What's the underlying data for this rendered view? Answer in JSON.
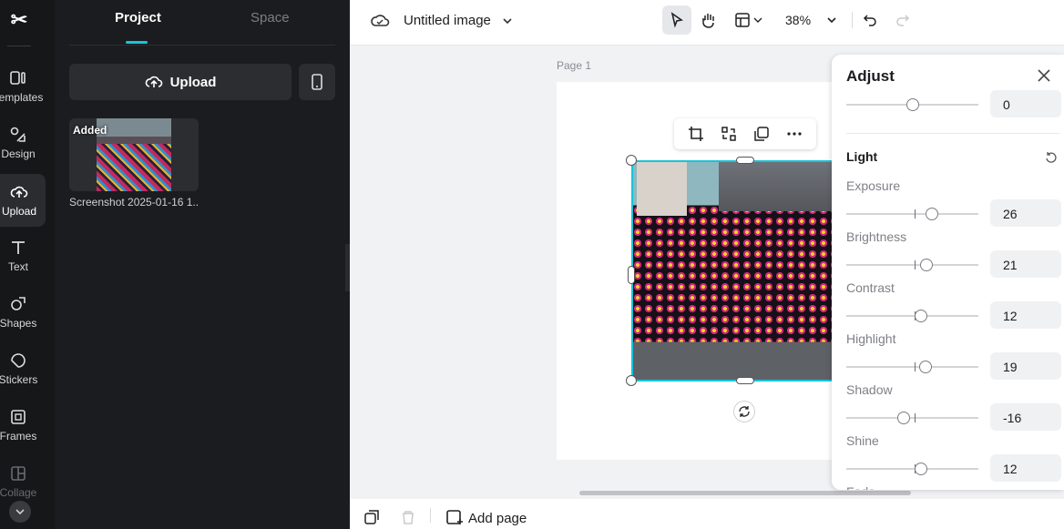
{
  "app": {
    "logo": "CapCut",
    "logo_glyph": "✂"
  },
  "rail": {
    "items": [
      {
        "label": "Templates",
        "icon": "templates-icon"
      },
      {
        "label": "Design",
        "icon": "design-icon"
      },
      {
        "label": "Upload",
        "icon": "upload-cloud-icon"
      },
      {
        "label": "Text",
        "icon": "text-icon"
      },
      {
        "label": "Shapes",
        "icon": "shapes-icon"
      },
      {
        "label": "Stickers",
        "icon": "stickers-icon"
      },
      {
        "label": "Frames",
        "icon": "frames-icon"
      },
      {
        "label": "Collage",
        "icon": "collage-icon"
      }
    ]
  },
  "panel": {
    "tabs": [
      "Project",
      "Space"
    ],
    "upload_label": "Upload",
    "media": {
      "badge": "Added",
      "name": "Screenshot 2025-01-16 1..."
    }
  },
  "topbar": {
    "title": "Untitled image",
    "zoom": "38%"
  },
  "canvas": {
    "page_label": "Page 1"
  },
  "bottom": {
    "add_page": "Add page"
  },
  "adjust": {
    "title": "Adjust",
    "top_value": "0",
    "section": "Light",
    "rows": [
      {
        "label": "Exposure",
        "value": "26"
      },
      {
        "label": "Brightness",
        "value": "21"
      },
      {
        "label": "Contrast",
        "value": "12"
      },
      {
        "label": "Highlight",
        "value": "19"
      },
      {
        "label": "Shadow",
        "value": "-16"
      },
      {
        "label": "Shine",
        "value": "12"
      },
      {
        "label": "Fade",
        "value": ""
      }
    ],
    "levels": [
      0.13,
      0.09,
      0.05,
      0.08,
      -0.08,
      0.05
    ]
  },
  "colors": {
    "accent": "#18c4d8",
    "rail_bg": "#161719",
    "panel_bg": "#1b1c1f"
  }
}
